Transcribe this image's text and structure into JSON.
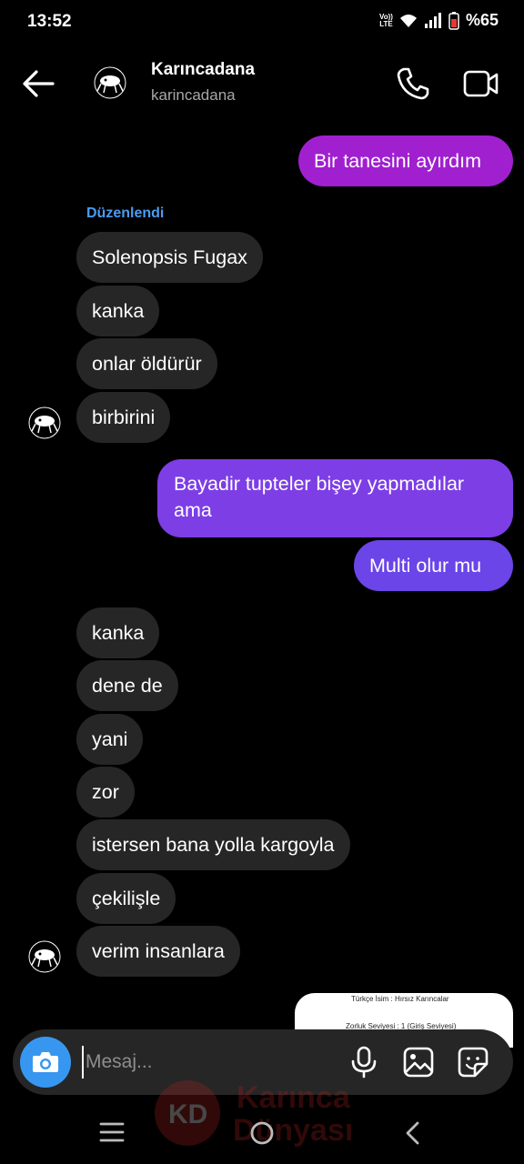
{
  "status_bar": {
    "time": "13:52",
    "volte": "Vo)) LTE",
    "battery": "%65",
    "icons": [
      "volte-icon",
      "wifi-icon",
      "signal-icon",
      "battery-icon"
    ]
  },
  "header": {
    "name": "Karıncadana",
    "username": "karincadana",
    "icons": [
      "back-arrow-icon",
      "phone-icon",
      "video-camera-icon"
    ]
  },
  "edited_label": "Düzenlendi",
  "messages": [
    {
      "side": "out",
      "text": "Bir tanesini ayırdım"
    },
    {
      "side": "in",
      "text": "Solenopsis Fugax"
    },
    {
      "side": "in",
      "text": "kanka"
    },
    {
      "side": "in",
      "text": "onlar öldürür"
    },
    {
      "side": "in",
      "text": "birbirini"
    },
    {
      "side": "out",
      "text": "Bayadir tupteler bişey yapmadılar ama"
    },
    {
      "side": "out",
      "text": "Multi olur mu"
    },
    {
      "side": "in",
      "text": "kanka"
    },
    {
      "side": "in",
      "text": "dene de"
    },
    {
      "side": "in",
      "text": "yani"
    },
    {
      "side": "in",
      "text": "zor"
    },
    {
      "side": "in",
      "text": "istersen bana yolla kargoyla"
    },
    {
      "side": "in",
      "text": "çekilişle"
    },
    {
      "side": "in",
      "text": "verim insanlara"
    }
  ],
  "image_preview": {
    "line1": "Türkçe İsim : Hırsız Karıncalar",
    "line2": "Zorluk Seviyesi : 1 (Giriş Seviyesi)"
  },
  "composer": {
    "placeholder": "Mesaj...",
    "icons": [
      "camera-icon",
      "microphone-icon",
      "gallery-icon",
      "sticker-icon"
    ]
  },
  "watermark": {
    "line1": "Karınca",
    "line2": "Dünyası",
    "logo_letters": "KD"
  },
  "nav_bar": {
    "icons": [
      "menu-icon",
      "home-icon",
      "back-icon"
    ]
  },
  "colors": {
    "background": "#000000",
    "incoming_bubble": "#262626",
    "outgoing_top": "#a020d0",
    "outgoing_mid": "#7d3ee6",
    "outgoing_bottom": "#6b45e8",
    "edited_label": "#4c9cf0",
    "camera_button": "#3797f0"
  }
}
